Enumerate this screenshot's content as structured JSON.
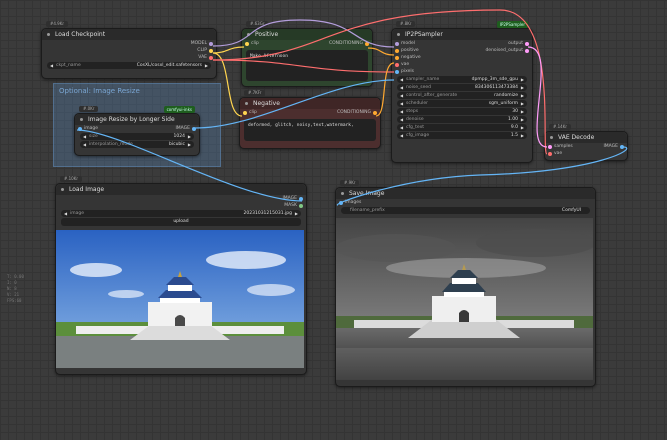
{
  "colors": {
    "model": "#b39ddb",
    "clip": "#ffd54f",
    "vae": "#ff6e6e",
    "conditioning": "#ffa931",
    "latent": "#ff9cf9",
    "image": "#64b5f6",
    "mask": "#81c784",
    "green_node": "#2e452e",
    "red_node": "#4c2e2e"
  },
  "group": {
    "title": "Optional: Image Resize"
  },
  "nodes": {
    "load_checkpoint": {
      "id": "#4.9Kr",
      "title": "Load Checkpoint",
      "outputs": [
        "MODEL",
        "CLIP",
        "VAE"
      ],
      "ckpt_label": "ckpt_name",
      "ckpt_value": "CosXL/cosxl_edit.safetensors"
    },
    "positive": {
      "id": "#.63Gr",
      "title": "Positive",
      "in_clip": "clip",
      "out": "CONDITIONING",
      "text": "Make Afternoon"
    },
    "negative": {
      "id": "#.7KFr",
      "title": "Negative",
      "in_clip": "clip",
      "out": "CONDITIONING",
      "text": "deformed, glitch, noisy,text,watermark,"
    },
    "ksampler": {
      "id": "#.8Kr",
      "badge": "IP2PSampler",
      "title": "IP2PSampler",
      "inputs": [
        "model",
        "positive",
        "negative",
        "vae",
        "pixels"
      ],
      "outputs": [
        "output",
        "denoised_output"
      ],
      "widgets": [
        {
          "label": "sampler_name",
          "value": "dpmpp_3m_sde_gpu"
        },
        {
          "label": "noise_seed",
          "value": "834306113473384"
        },
        {
          "label": "control_after_generate",
          "value": "randomize"
        },
        {
          "label": "scheduler",
          "value": "sgm_uniform"
        },
        {
          "label": "steps",
          "value": "30"
        },
        {
          "label": "denoise",
          "value": "1.00"
        },
        {
          "label": "cfg_text",
          "value": "9.0"
        },
        {
          "label": "cfg_image",
          "value": "1.5"
        }
      ]
    },
    "image_resize": {
      "id": "#.0Kr",
      "badge": "comfyui-inks",
      "title": "Image Resize by Longer Side",
      "in": "image",
      "out": "IMAGE",
      "widgets": [
        {
          "label": "size",
          "value": "1024"
        },
        {
          "label": "interpolation_mode",
          "value": "bicubic"
        }
      ]
    },
    "vae_decode": {
      "id": "#.14Kr",
      "title": "VAE Decode",
      "inputs": [
        "samples",
        "vae"
      ],
      "out": "IMAGE"
    },
    "load_image": {
      "id": "#.10Kr",
      "title": "Load Image",
      "outputs": [
        "IMAGE",
        "MASK"
      ],
      "image_label": "image",
      "image_value": "20231031215031.jpg",
      "upload": "upload"
    },
    "save_image": {
      "id": "#.9Kr",
      "title": "Save Image",
      "in": "images",
      "prefix_label": "filename_prefix",
      "prefix_value": "ComfyUI"
    }
  },
  "side_info": [
    "T: 0.00",
    "I: 0",
    "N: 8",
    "V: 21",
    "FPS:60"
  ]
}
